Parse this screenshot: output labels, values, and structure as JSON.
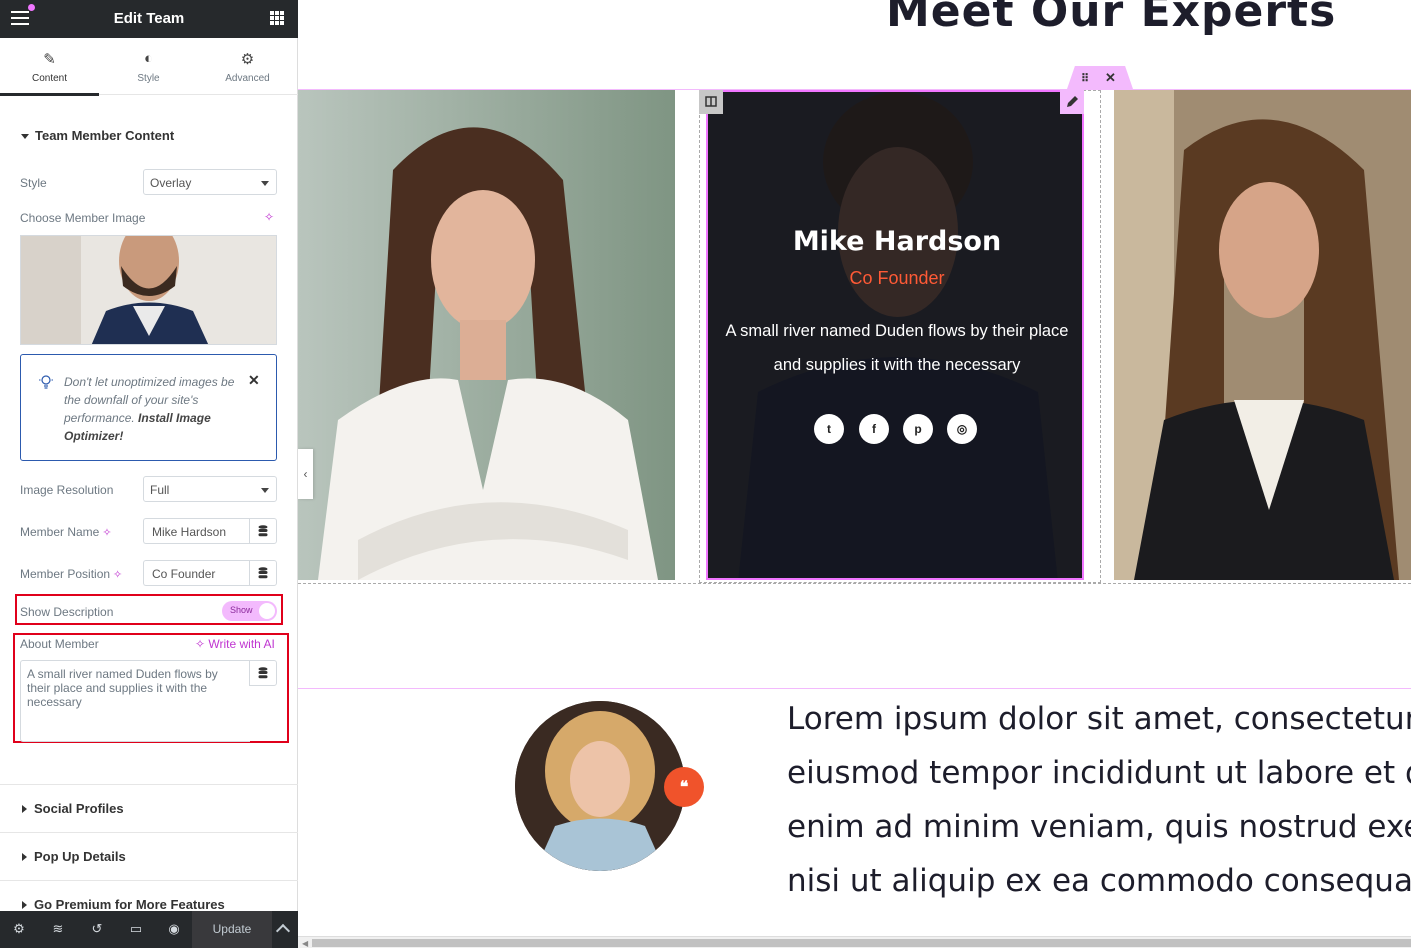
{
  "panel": {
    "title": "Edit Team",
    "tabs": [
      {
        "label": "Content",
        "icon": "pencil-icon"
      },
      {
        "label": "Style",
        "icon": "half-circle-icon"
      },
      {
        "label": "Advanced",
        "icon": "gear-icon"
      }
    ],
    "active_tab": "Content",
    "section_title": "Team Member Content",
    "style_label": "Style",
    "style_value": "Overlay",
    "image_label": "Choose Member Image",
    "notice": {
      "text": "Don't let unoptimized images be the downfall of your site's performance.",
      "link": "Install Image Optimizer!"
    },
    "resolution_label": "Image Resolution",
    "resolution_value": "Full",
    "name_label": "Member Name",
    "name_value": "Mike Hardson",
    "position_label": "Member Position",
    "position_value": "Co Founder",
    "show_desc_label": "Show Description",
    "show_desc_toggle": "Show",
    "about_label": "About Member",
    "write_ai": "Write with AI",
    "about_value": "A small river named Duden flows by their place and supplies it with the necessary",
    "collapsed_sections": [
      "Social Profiles",
      "Pop Up Details",
      "Go Premium for More Features"
    ],
    "update_label": "Update",
    "colors": {
      "dark": "#26292c",
      "accent": "#c036d1",
      "highlight": "#e0001b",
      "toggle": "#f3bafd"
    }
  },
  "canvas": {
    "heading": "Meet Our Experts",
    "card": {
      "name": "Mike Hardson",
      "position": "Co Founder",
      "description": "A small river named Duden flows by their place and supplies it with the necessary",
      "social": [
        "twitter-icon",
        "facebook-icon",
        "pinterest-icon",
        "instagram-icon"
      ]
    },
    "lorem_lines": [
      "Lorem ipsum dolor sit amet, consectetur adip",
      "eiusmod tempor incididunt ut labore et dolor",
      "enim ad minim veniam, quis nostrud exercita",
      "nisi ut aliquip ex ea commodo consequat."
    ],
    "colors": {
      "position": "#ff5a36",
      "quote_badge": "#f0532b",
      "selection": "#f076ff"
    }
  }
}
